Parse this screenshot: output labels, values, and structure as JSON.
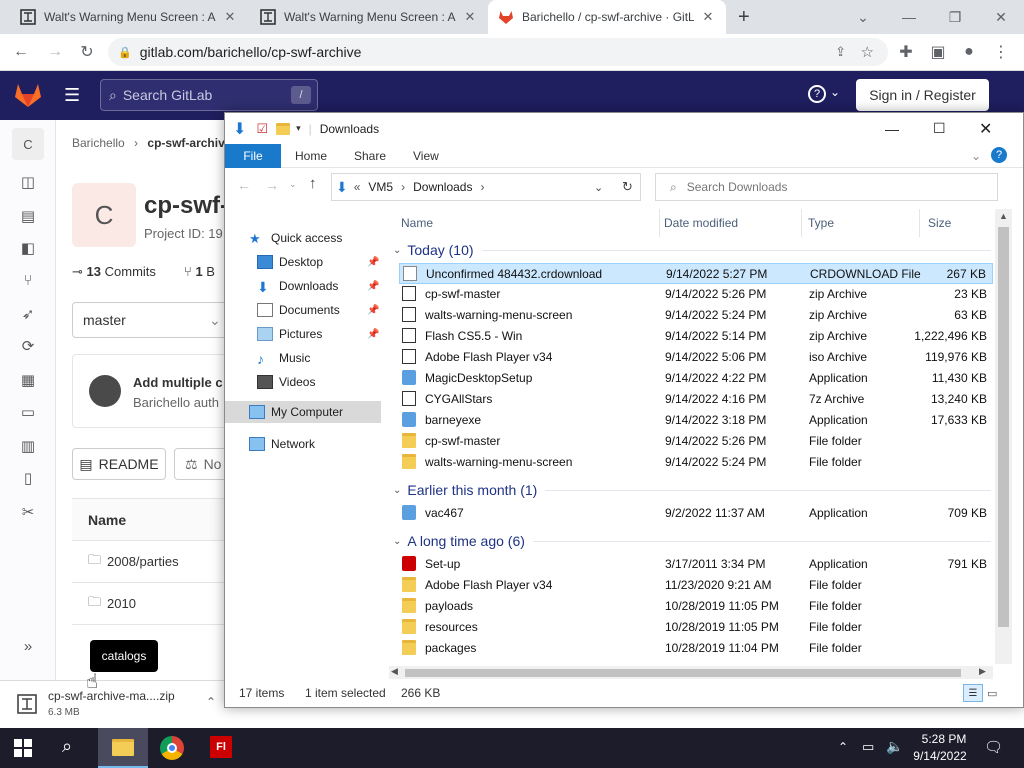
{
  "browser": {
    "tabs": [
      {
        "title": "Walt's Warning Menu Screen : Ar"
      },
      {
        "title": "Walt's Warning Menu Screen : Ar"
      },
      {
        "title": "Barichello / cp-swf-archive · GitL"
      }
    ],
    "new_tab": "+",
    "url": "gitlab.com/barichello/cp-swf-archive"
  },
  "gitlab": {
    "search_placeholder": "Search GitLab",
    "search_shortcut": "/",
    "help_icon": "?",
    "sign_in": "Sign in / Register",
    "avatar_letter": "C",
    "breadcrumb": [
      "Barichello",
      "cp-swf-archive"
    ],
    "project_letter": "C",
    "project_name": "cp-swf-a",
    "project_id": "Project ID: 19",
    "commits_count": "13",
    "commits_label": "Commits",
    "branches_count": "1",
    "branches_label": "B",
    "branch": "master",
    "commit_title": "Add multiple c",
    "commit_author": "Barichello auth",
    "readme": "README",
    "no_label": "No",
    "table_header": "Name",
    "rows": [
      "2008/parties",
      "2010"
    ],
    "tooltip": "catalogs",
    "collapse_icon": "»"
  },
  "download_shelf": {
    "filename": "cp-swf-archive-ma....zip",
    "size": "6.3 MB"
  },
  "explorer": {
    "title": "Downloads",
    "ribbon_tabs": [
      "File",
      "Home",
      "Share",
      "View"
    ],
    "path": [
      "VM5",
      "Downloads"
    ],
    "path_prefix": "«",
    "search_placeholder": "Search Downloads",
    "nav": {
      "quick_access": "Quick access",
      "items": [
        "Desktop",
        "Downloads",
        "Documents",
        "Pictures",
        "Music",
        "Videos"
      ],
      "my_computer": "My Computer",
      "network": "Network"
    },
    "columns": [
      "Name",
      "Date modified",
      "Type",
      "Size"
    ],
    "groups": [
      {
        "label": "Today (10)",
        "files": [
          {
            "name": "Unconfirmed 484432.crdownload",
            "date": "9/14/2022 5:27 PM",
            "type": "CRDOWNLOAD File",
            "size": "267 KB",
            "icon": "file-icon",
            "selected": true
          },
          {
            "name": "cp-swf-master",
            "date": "9/14/2022 5:26 PM",
            "type": "zip Archive",
            "size": "23 KB",
            "icon": "zip-icon"
          },
          {
            "name": "walts-warning-menu-screen",
            "date": "9/14/2022 5:24 PM",
            "type": "zip Archive",
            "size": "63 KB",
            "icon": "zip-icon"
          },
          {
            "name": "Flash CS5.5 - Win",
            "date": "9/14/2022 5:14 PM",
            "type": "zip Archive",
            "size": "1,222,496 KB",
            "icon": "zip-icon"
          },
          {
            "name": "Adobe Flash Player v34",
            "date": "9/14/2022 5:06 PM",
            "type": "iso Archive",
            "size": "119,976 KB",
            "icon": "iso-icon"
          },
          {
            "name": "MagicDesktopSetup",
            "date": "9/14/2022 4:22 PM",
            "type": "Application",
            "size": "11,430 KB",
            "icon": "app-icon"
          },
          {
            "name": "CYGAllStars",
            "date": "9/14/2022 4:16 PM",
            "type": "7z Archive",
            "size": "13,240 KB",
            "icon": "zip-icon"
          },
          {
            "name": "barneyexe",
            "date": "9/14/2022 3:18 PM",
            "type": "Application",
            "size": "17,633 KB",
            "icon": "app-icon"
          },
          {
            "name": "cp-swf-master",
            "date": "9/14/2022 5:26 PM",
            "type": "File folder",
            "size": "",
            "icon": "folder-icon"
          },
          {
            "name": "walts-warning-menu-screen",
            "date": "9/14/2022 5:24 PM",
            "type": "File folder",
            "size": "",
            "icon": "folder-icon"
          }
        ]
      },
      {
        "label": "Earlier this month (1)",
        "files": [
          {
            "name": "vac467",
            "date": "9/2/2022 11:37 AM",
            "type": "Application",
            "size": "709 KB",
            "icon": "app-icon"
          }
        ]
      },
      {
        "label": "A long time ago (6)",
        "files": [
          {
            "name": "Set-up",
            "date": "3/17/2011 3:34 PM",
            "type": "Application",
            "size": "791 KB",
            "icon": "flash-icon"
          },
          {
            "name": "Adobe Flash Player v34",
            "date": "11/23/2020 9:21 AM",
            "type": "File folder",
            "size": "",
            "icon": "folder-icon"
          },
          {
            "name": "payloads",
            "date": "10/28/2019 11:05 PM",
            "type": "File folder",
            "size": "",
            "icon": "folder-icon"
          },
          {
            "name": "resources",
            "date": "10/28/2019 11:05 PM",
            "type": "File folder",
            "size": "",
            "icon": "folder-icon"
          },
          {
            "name": "packages",
            "date": "10/28/2019 11:04 PM",
            "type": "File folder",
            "size": "",
            "icon": "folder-icon"
          }
        ]
      }
    ],
    "status": {
      "items": "17 items",
      "selected": "1 item selected",
      "size": "266 KB"
    }
  },
  "taskbar": {
    "time": "5:28 PM",
    "date": "9/14/2022"
  }
}
